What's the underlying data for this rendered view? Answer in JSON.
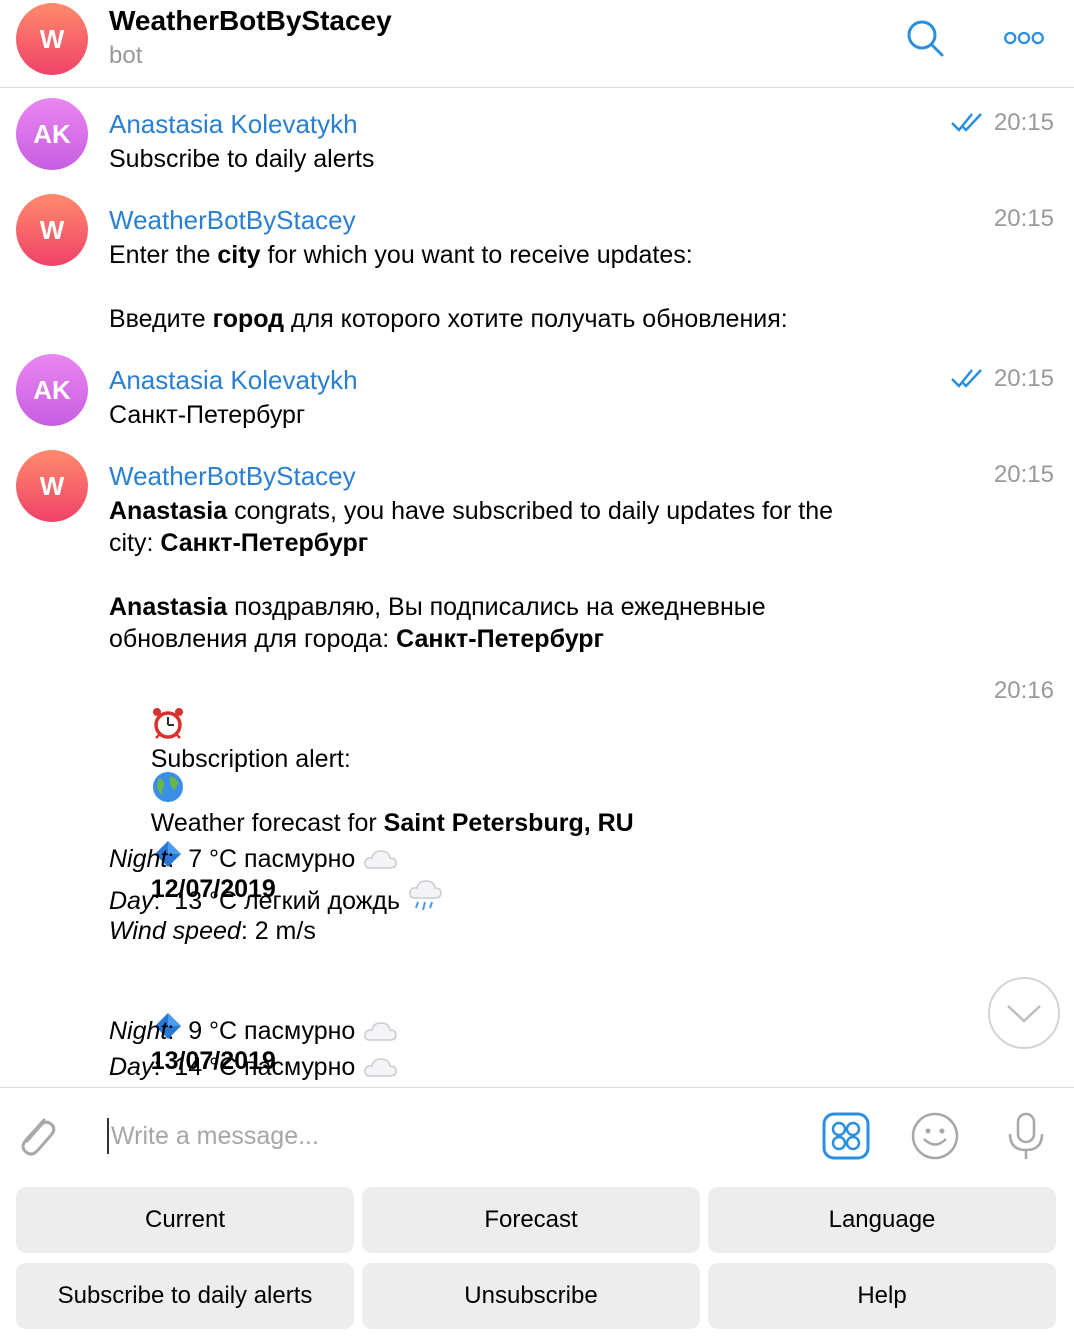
{
  "header": {
    "avatar_letter": "W",
    "title": "WeatherBotByStacey",
    "subtitle": "bot",
    "search_icon": "search-icon",
    "more_icon": "more-icon"
  },
  "colors": {
    "link_blue": "#2b7fd1",
    "bot_avatar": "#f0436a",
    "user_avatar": "#c85de3",
    "muted": "#999999",
    "button_bg": "#ededed"
  },
  "messages": [
    {
      "avatar": "AK",
      "sender": "Anastasia Kolevatykh",
      "time": "20:15",
      "read": true,
      "text": "Subscribe to daily alerts"
    },
    {
      "avatar": "W",
      "sender": "WeatherBotByStacey",
      "time": "20:15",
      "text_en_pre": "Enter the ",
      "text_en_bold": "city",
      "text_en_post": " for which you want to receive updates:",
      "text_ru_pre": "Введите ",
      "text_ru_bold": "город",
      "text_ru_post": " для которого хотите получать обновления:"
    },
    {
      "avatar": "AK",
      "sender": "Anastasia Kolevatykh",
      "time": "20:15",
      "read": true,
      "text": "Санкт-Петербург"
    },
    {
      "avatar": "W",
      "sender": "WeatherBotByStacey",
      "time": "20:15",
      "en_name": "Anastasia",
      "en_line1_rest": " congrats, you have subscribed to daily updates for the",
      "en_line2_pre": "city: ",
      "en_city": "Санкт-Петербург",
      "ru_name": "Anastasia",
      "ru_line1_rest": " поздравляю, Вы подписались на ежедневные",
      "ru_line2_pre": "обновления для города: ",
      "ru_city": "Санкт-Петербург"
    },
    {
      "time": "20:16",
      "alert_icon": "alarm-clock-icon",
      "alert_text": "Subscription alert:",
      "globe_icon": "globe-icon",
      "forecast_pre": "Weather forecast for ",
      "forecast_city": "Saint Petersburg, RU",
      "days": [
        {
          "date": "12/07/2019",
          "night_label": "Night",
          "night_value": ":  7 °C пасмурно",
          "night_icon": "cloud-icon",
          "day_label": "Day",
          "day_value": ":  13 °C легкий дождь",
          "day_icon": "rain-cloud-icon",
          "wind_label": "Wind speed",
          "wind_value": ": 2 m/s"
        },
        {
          "date": "13/07/2019",
          "night_label": "Night",
          "night_value": ":  9 °C пасмурно",
          "night_icon": "cloud-icon",
          "day_label": "Day",
          "day_value": ":  14 °C пасмурно",
          "day_icon": "cloud-icon"
        }
      ]
    }
  ],
  "composer": {
    "placeholder": "Write a message...",
    "attach_icon": "paperclip-icon",
    "commands_icon": "bot-commands-icon",
    "emoji_icon": "smiley-icon",
    "mic_icon": "microphone-icon"
  },
  "keyboard": {
    "row1": [
      "Current",
      "Forecast",
      "Language"
    ],
    "row2": [
      "Subscribe to daily alerts",
      "Unsubscribe",
      "Help"
    ]
  }
}
